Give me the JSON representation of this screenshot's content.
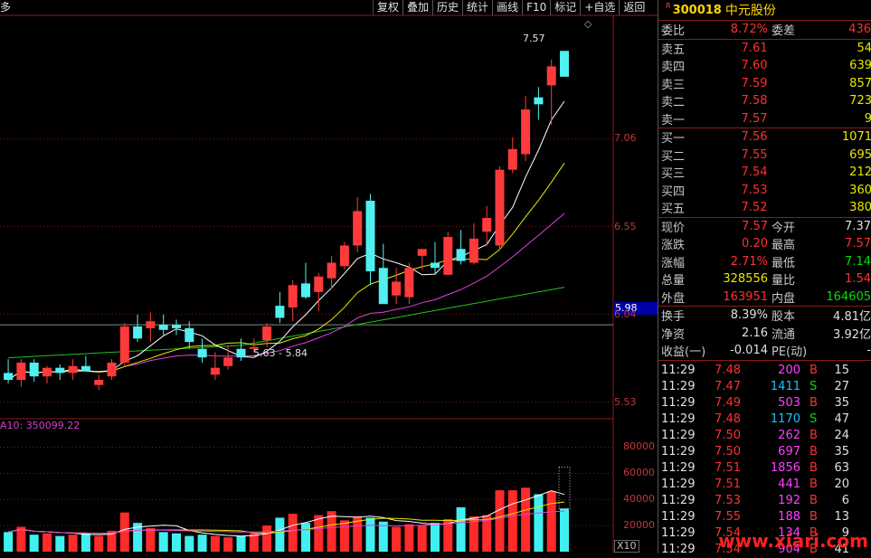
{
  "menu_label": "多",
  "toolbar": [
    "复权",
    "叠加",
    "历史",
    "统计",
    "画线",
    "F10",
    "标记",
    "+自选",
    "返回"
  ],
  "price_axis": [
    "7.06",
    "6.55",
    "6.04",
    "5.53"
  ],
  "volume_axis": [
    "80000",
    "60000",
    "40000",
    "20000"
  ],
  "current_price_tag": "5.98",
  "ma_volume_label": "A10: 350099.22",
  "high_label": "7.57",
  "low_label": "5.63 - 5.84",
  "volume_multiplier": "X10",
  "colors": {
    "up": "#ff3a3a",
    "down": "#50f0f0",
    "ma5": "#ffffff",
    "ma10": "#e8e800",
    "ma20": "#e040e0",
    "ma60": "#20c020"
  },
  "chart_data": {
    "type": "candlestick",
    "price_range": [
      5.45,
      7.75
    ],
    "volume_range": [
      0,
      90000
    ],
    "candles": [
      {
        "o": 5.7,
        "h": 5.78,
        "l": 5.64,
        "c": 5.66,
        "v": 15000
      },
      {
        "o": 5.66,
        "h": 5.78,
        "l": 5.62,
        "c": 5.76,
        "v": 19000
      },
      {
        "o": 5.76,
        "h": 5.78,
        "l": 5.65,
        "c": 5.68,
        "v": 13000
      },
      {
        "o": 5.68,
        "h": 5.74,
        "l": 5.64,
        "c": 5.73,
        "v": 14000
      },
      {
        "o": 5.73,
        "h": 5.75,
        "l": 5.66,
        "c": 5.7,
        "v": 12000
      },
      {
        "o": 5.7,
        "h": 5.78,
        "l": 5.66,
        "c": 5.74,
        "v": 13000
      },
      {
        "o": 5.74,
        "h": 5.8,
        "l": 5.71,
        "c": 5.71,
        "v": 14000
      },
      {
        "o": 5.63,
        "h": 5.69,
        "l": 5.6,
        "c": 5.66,
        "v": 12000
      },
      {
        "o": 5.68,
        "h": 5.78,
        "l": 5.66,
        "c": 5.76,
        "v": 16000
      },
      {
        "o": 5.76,
        "h": 5.99,
        "l": 5.74,
        "c": 5.97,
        "v": 30000
      },
      {
        "o": 5.97,
        "h": 6.04,
        "l": 5.88,
        "c": 5.9,
        "v": 22000
      },
      {
        "o": 5.96,
        "h": 6.05,
        "l": 5.88,
        "c": 6.0,
        "v": 18000
      },
      {
        "o": 5.98,
        "h": 6.04,
        "l": 5.92,
        "c": 5.95,
        "v": 15000
      },
      {
        "o": 5.98,
        "h": 6.01,
        "l": 5.92,
        "c": 5.96,
        "v": 14000
      },
      {
        "o": 5.96,
        "h": 6.0,
        "l": 5.84,
        "c": 5.88,
        "v": 12000
      },
      {
        "o": 5.84,
        "h": 5.9,
        "l": 5.76,
        "c": 5.79,
        "v": 13000
      },
      {
        "o": 5.69,
        "h": 5.82,
        "l": 5.66,
        "c": 5.73,
        "v": 12000
      },
      {
        "o": 5.74,
        "h": 5.86,
        "l": 5.72,
        "c": 5.79,
        "v": 11000
      },
      {
        "o": 5.84,
        "h": 5.9,
        "l": 5.77,
        "c": 5.79,
        "v": 12000
      },
      {
        "o": 5.84,
        "h": 5.9,
        "l": 5.82,
        "c": 5.85,
        "v": 14000
      },
      {
        "o": 5.89,
        "h": 5.99,
        "l": 5.85,
        "c": 5.97,
        "v": 20000
      },
      {
        "o": 6.09,
        "h": 6.17,
        "l": 5.99,
        "c": 6.02,
        "v": 26000
      },
      {
        "o": 6.08,
        "h": 6.24,
        "l": 6.0,
        "c": 6.21,
        "v": 29000
      },
      {
        "o": 6.22,
        "h": 6.34,
        "l": 6.13,
        "c": 6.14,
        "v": 22000
      },
      {
        "o": 6.17,
        "h": 6.28,
        "l": 6.06,
        "c": 6.26,
        "v": 28000
      },
      {
        "o": 6.25,
        "h": 6.38,
        "l": 6.19,
        "c": 6.34,
        "v": 31000
      },
      {
        "o": 6.32,
        "h": 6.46,
        "l": 6.3,
        "c": 6.44,
        "v": 24000
      },
      {
        "o": 6.44,
        "h": 6.72,
        "l": 6.4,
        "c": 6.64,
        "v": 27000
      },
      {
        "o": 6.7,
        "h": 6.74,
        "l": 6.21,
        "c": 6.29,
        "v": 26000
      },
      {
        "o": 6.31,
        "h": 6.45,
        "l": 6.16,
        "c": 6.1,
        "v": 23000
      },
      {
        "o": 6.15,
        "h": 6.31,
        "l": 6.1,
        "c": 6.23,
        "v": 19000
      },
      {
        "o": 6.14,
        "h": 6.34,
        "l": 6.1,
        "c": 6.31,
        "v": 21000
      },
      {
        "o": 6.38,
        "h": 6.41,
        "l": 6.3,
        "c": 6.42,
        "v": 20000
      },
      {
        "o": 6.34,
        "h": 6.46,
        "l": 6.27,
        "c": 6.31,
        "v": 22000
      },
      {
        "o": 6.27,
        "h": 6.52,
        "l": 6.27,
        "c": 6.49,
        "v": 25000
      },
      {
        "o": 6.42,
        "h": 6.53,
        "l": 6.33,
        "c": 6.35,
        "v": 34000
      },
      {
        "o": 6.34,
        "h": 6.57,
        "l": 6.33,
        "c": 6.48,
        "v": 27000
      },
      {
        "o": 6.52,
        "h": 6.67,
        "l": 6.44,
        "c": 6.6,
        "v": 28000
      },
      {
        "o": 6.44,
        "h": 6.9,
        "l": 6.41,
        "c": 6.88,
        "v": 47000
      },
      {
        "o": 6.88,
        "h": 7.07,
        "l": 6.86,
        "c": 7.0,
        "v": 47000
      },
      {
        "o": 6.97,
        "h": 7.31,
        "l": 6.93,
        "c": 7.23,
        "v": 49000
      },
      {
        "o": 7.3,
        "h": 7.36,
        "l": 7.17,
        "c": 7.26,
        "v": 44000
      },
      {
        "o": 7.37,
        "h": 7.52,
        "l": 7.14,
        "c": 7.48,
        "v": 46000
      },
      {
        "o": 7.57,
        "h": 7.57,
        "l": 7.42,
        "c": 7.42,
        "v": 33000
      }
    ]
  },
  "panel": {
    "code": "300018",
    "name": "中元股份",
    "badge": "R",
    "weibi_label": "委比",
    "weibi": "8.72%",
    "weicha_label": "委差",
    "weicha": "436",
    "asks": [
      {
        "label": "卖五",
        "price": "7.61",
        "vol": "54"
      },
      {
        "label": "卖四",
        "price": "7.60",
        "vol": "639"
      },
      {
        "label": "卖三",
        "price": "7.59",
        "vol": "857"
      },
      {
        "label": "卖二",
        "price": "7.58",
        "vol": "723"
      },
      {
        "label": "卖一",
        "price": "7.57",
        "vol": "9"
      }
    ],
    "bids": [
      {
        "label": "买一",
        "price": "7.56",
        "vol": "1071"
      },
      {
        "label": "买二",
        "price": "7.55",
        "vol": "695"
      },
      {
        "label": "买三",
        "price": "7.54",
        "vol": "212"
      },
      {
        "label": "买四",
        "price": "7.53",
        "vol": "360"
      },
      {
        "label": "买五",
        "price": "7.52",
        "vol": "380"
      }
    ],
    "quote": [
      {
        "l1": "现价",
        "v1": "7.57",
        "c1": "red",
        "l2": "今开",
        "v2": "7.37",
        "c2": "white"
      },
      {
        "l1": "涨跌",
        "v1": "0.20",
        "c1": "red",
        "l2": "最高",
        "v2": "7.57",
        "c2": "red"
      },
      {
        "l1": "涨幅",
        "v1": "2.71%",
        "c1": "red",
        "l2": "最低",
        "v2": "7.14",
        "c2": "green"
      },
      {
        "l1": "总量",
        "v1": "328556",
        "c1": "yellow",
        "l2": "量比",
        "v2": "1.54",
        "c2": "red"
      },
      {
        "l1": "外盘",
        "v1": "163951",
        "c1": "red",
        "l2": "内盘",
        "v2": "164605",
        "c2": "green"
      }
    ],
    "fund": [
      {
        "l1": "换手",
        "v1": "8.39%",
        "l2": "股本",
        "v2": "4.81亿"
      },
      {
        "l1": "净资",
        "v1": "2.16",
        "l2": "流通",
        "v2": "3.92亿"
      },
      {
        "l1": "收益(一)",
        "v1": "-0.014",
        "l2": "PE(动)",
        "v2": "-"
      }
    ],
    "ticks": [
      {
        "t": "11:29",
        "p": "7.48",
        "v": "200",
        "s": "B",
        "n": "15"
      },
      {
        "t": "11:29",
        "p": "7.47",
        "v": "1411",
        "s": "S",
        "n": "27"
      },
      {
        "t": "11:29",
        "p": "7.49",
        "v": "503",
        "s": "B",
        "n": "35"
      },
      {
        "t": "11:29",
        "p": "7.48",
        "v": "1170",
        "s": "S",
        "n": "47"
      },
      {
        "t": "11:29",
        "p": "7.50",
        "v": "262",
        "s": "B",
        "n": "24"
      },
      {
        "t": "11:29",
        "p": "7.50",
        "v": "697",
        "s": "B",
        "n": "35"
      },
      {
        "t": "11:29",
        "p": "7.51",
        "v": "1856",
        "s": "B",
        "n": "63"
      },
      {
        "t": "11:29",
        "p": "7.51",
        "v": "441",
        "s": "B",
        "n": "20"
      },
      {
        "t": "11:29",
        "p": "7.53",
        "v": "192",
        "s": "B",
        "n": "6"
      },
      {
        "t": "11:29",
        "p": "7.55",
        "v": "188",
        "s": "B",
        "n": "13"
      },
      {
        "t": "11:29",
        "p": "7.54",
        "v": "134",
        "s": "B",
        "n": "9"
      },
      {
        "t": "11:29",
        "p": "7.54",
        "v": "904",
        "s": "B",
        "n": "41"
      }
    ],
    "watermark": "www.xiari.com"
  }
}
